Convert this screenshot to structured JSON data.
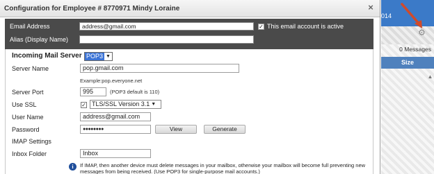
{
  "dialog": {
    "title": "Configuration for Employee # 8770971 Mindy Loraine",
    "close": "×"
  },
  "top": {
    "email_label": "Email Address",
    "email_value": "address@gmail.com",
    "active_checked": "✓",
    "active_label": "This email account is active",
    "alias_label": "Alias (Display Name)",
    "alias_value": ""
  },
  "incoming": {
    "label": "Incoming Mail Server",
    "protocol": "POP3",
    "server_name_label": "Server Name",
    "server_name_value": "pop.gmail.com",
    "server_example": "Example:pop.everyone.net",
    "server_port_label": "Server Port",
    "server_port_value": "995",
    "port_note": "(POP3 default is 110)",
    "ssl_label": "Use SSL",
    "ssl_checked": "✓",
    "ssl_version": "TLS/SSL Version 3.1",
    "username_label": "User Name",
    "username_value": "address@gmail.com",
    "password_label": "Password",
    "password_value": "●●●●●●●●",
    "view_button": "View",
    "generate_button": "Generate",
    "imap_label": "IMAP Settings",
    "inbox_label": "Inbox Folder",
    "inbox_value": "Inbox",
    "info_icon": "i",
    "info_text": "If IMAP, then another device must delete messages in your mailbox, otherwise your mailbox will become full preventing new messages from being received. (Use POP3 for single-purpose mail accounts.)"
  },
  "right": {
    "year_fragment": "014",
    "messages": "0 Messages",
    "size_header": "Size",
    "gear_icon": "gear-icon",
    "accent": "#3b7ac8",
    "annotation_color": "#d04a2a"
  }
}
